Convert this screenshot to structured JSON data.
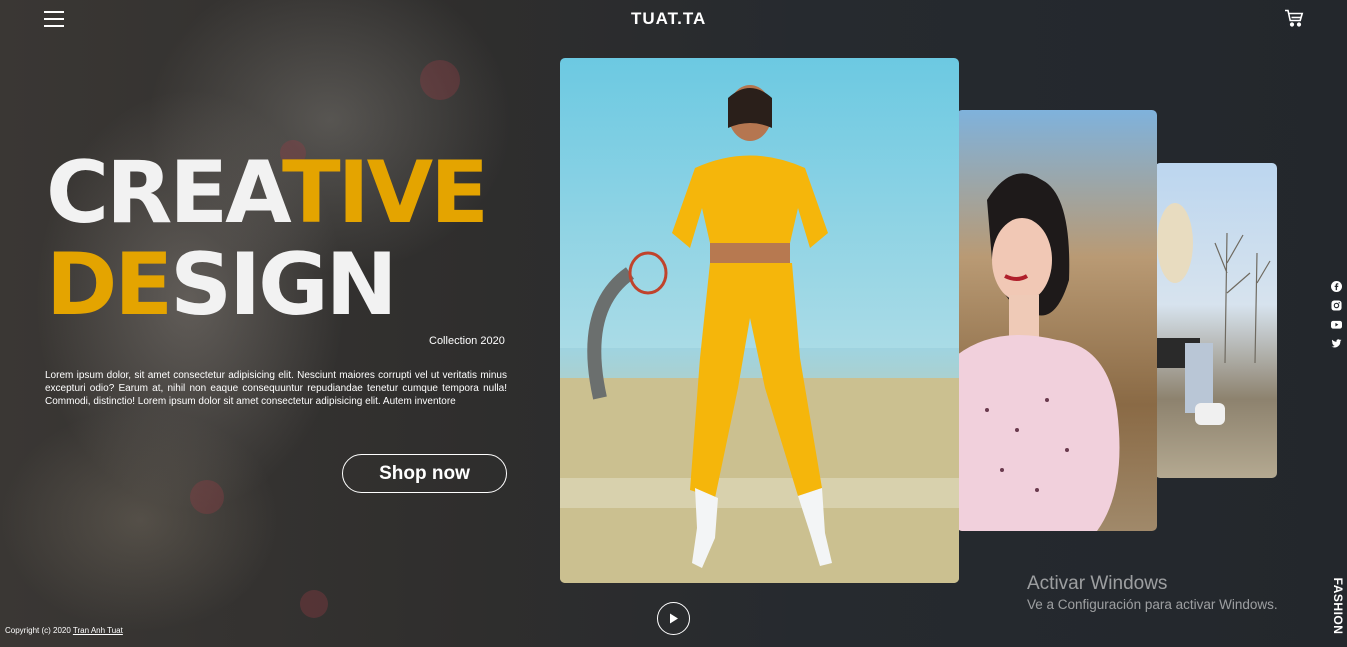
{
  "header": {
    "logo": "TUAT.TA",
    "menu_icon": "hamburger-menu-icon",
    "cart_icon": "cart-icon"
  },
  "hero": {
    "line1_white": "CREA",
    "line1_yellow": "TIVE",
    "line2_yellow": "DE",
    "line2_white": "SIGN",
    "collection": "Collection 2020",
    "description": "Lorem ipsum dolor, sit amet consectetur adipisicing elit. Nesciunt maiores corrupti vel ut veritatis minus excepturi odio? Earum at, nihil non eaque consequuntur repudiandae tenetur cumque tempora nulla! Commodi, distinctio! Lorem ipsum dolor sit amet consectetur adipisicing elit. Autem inventore",
    "cta": "Shop now"
  },
  "gallery": {
    "cards": [
      {
        "name": "model-yellow-tracksuit"
      },
      {
        "name": "model-pink-dress"
      },
      {
        "name": "model-sitting-winter"
      }
    ],
    "play_icon": "play-icon"
  },
  "social": [
    "facebook-icon",
    "instagram-icon",
    "youtube-icon",
    "twitter-icon"
  ],
  "side_label": "FASHION",
  "watermark": {
    "title": "Activar Windows",
    "subtitle": "Ve a Configuración para activar Windows."
  },
  "footer": {
    "copyright_prefix": "Copyright (c) 2020",
    "author": "Tran Anh Tuat"
  },
  "colors": {
    "accent": "#e4a400",
    "background": "#1f2328",
    "text": "#ffffff"
  }
}
